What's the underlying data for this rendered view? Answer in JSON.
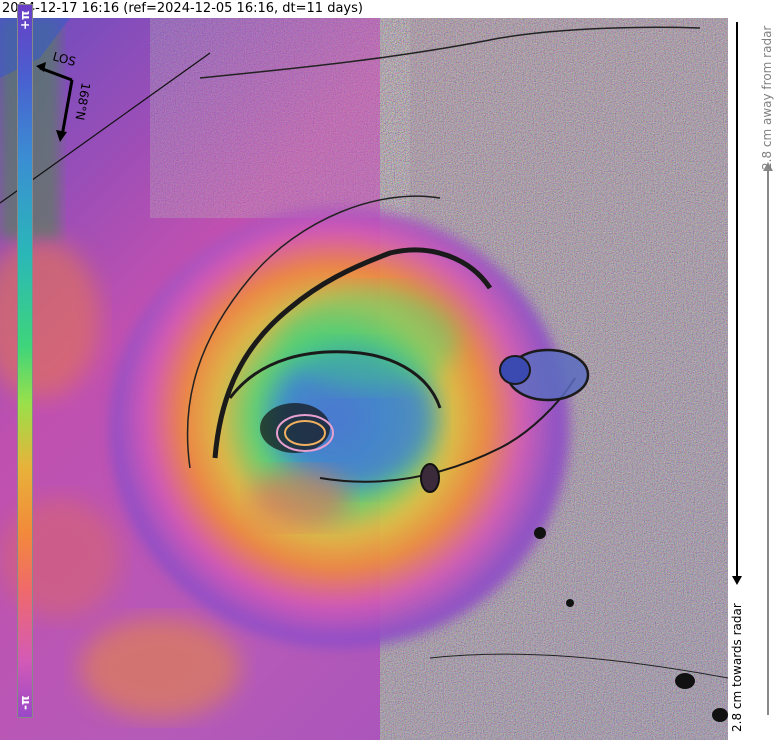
{
  "title": "2024-12-17 16:16 (ref=2024-12-05 16:16, dt=11 days)",
  "compass": {
    "los_label": "LOS",
    "heading_label": "168°N"
  },
  "colorbar": {
    "top_label": "+π",
    "bottom_label": "-π",
    "away_label": "2.8 cm away from radar",
    "towards_label": "2.8 cm towards radar"
  },
  "colors": {
    "purple": "#b050b8",
    "magenta": "#d45ab6",
    "blue": "#4a6fd0",
    "cyan": "#2ab7b8",
    "green": "#5fd86a",
    "yellow": "#e0c040",
    "orange": "#f08a3a"
  }
}
